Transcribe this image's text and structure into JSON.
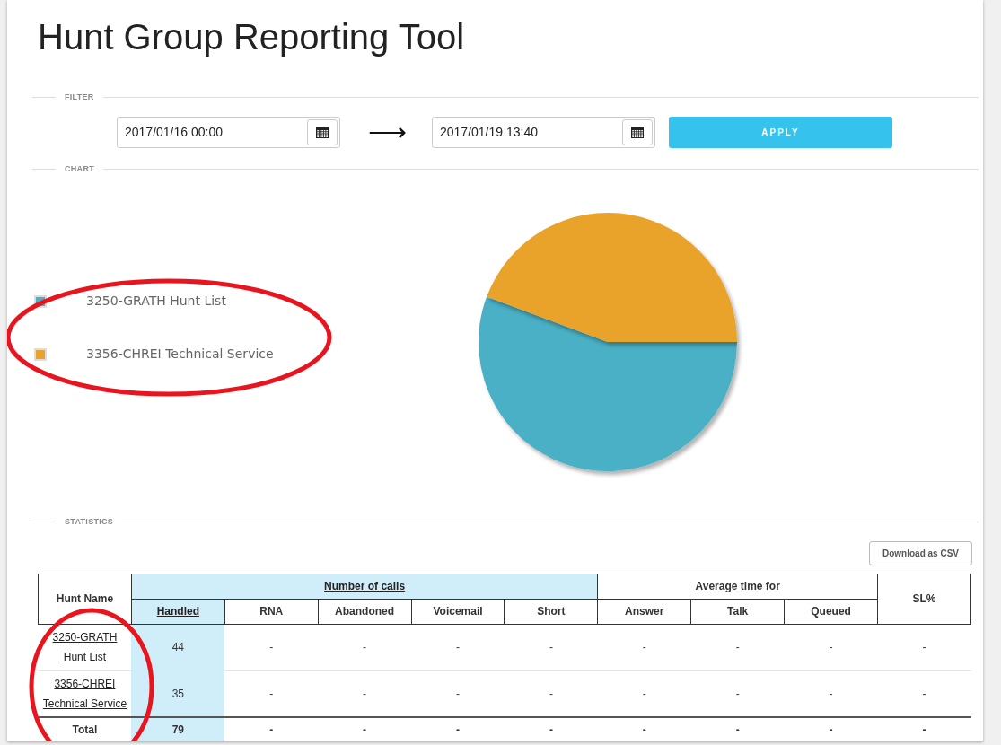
{
  "title": "Hunt Group Reporting Tool",
  "filter": {
    "section": "FILTER",
    "from": "2017/01/16 00:00",
    "arrow": "⟶",
    "to": "2017/01/19 13:40",
    "apply": "APPLY"
  },
  "chart": {
    "section": "CHART",
    "legend": [
      {
        "name": "3250-GRATH Hunt List",
        "color": "#4ab0c5"
      },
      {
        "name": "3356-CHREI Technical Service",
        "color": "#e9a22a"
      }
    ]
  },
  "statistics": {
    "section": "STATISTICS",
    "download": "Download as CSV"
  },
  "table": {
    "hunt_name_header": "Hunt Name",
    "sl_header": "SL%",
    "groups": [
      {
        "label": "Number of calls",
        "link": true,
        "highlighted": true,
        "columns": [
          {
            "label": "Handled",
            "link": true,
            "highlighted": true
          },
          {
            "label": "RNA",
            "link": false,
            "highlighted": false
          },
          {
            "label": "Abandoned",
            "link": false,
            "highlighted": false
          },
          {
            "label": "Voicemail",
            "link": false,
            "highlighted": false
          },
          {
            "label": "Short",
            "link": false,
            "highlighted": false
          }
        ]
      },
      {
        "label": "Average time for",
        "link": false,
        "highlighted": false,
        "columns": [
          {
            "label": "Answer",
            "link": false,
            "highlighted": false
          },
          {
            "label": "Talk",
            "link": false,
            "highlighted": false
          },
          {
            "label": "Queued",
            "link": false,
            "highlighted": false
          }
        ]
      }
    ],
    "rows": [
      {
        "kind": "entry",
        "name": "3250-GRATH Hunt List",
        "cells": [
          "44",
          "-",
          "-",
          "-",
          "-",
          "-",
          "-",
          "-",
          "-"
        ]
      },
      {
        "kind": "entry",
        "name": "3356-CHREI Technical Service",
        "cells": [
          "35",
          "-",
          "-",
          "-",
          "-",
          "-",
          "-",
          "-",
          "-"
        ]
      },
      {
        "kind": "total",
        "name": "Total",
        "cells": [
          "79",
          "-",
          "-",
          "-",
          "-",
          "-",
          "-",
          "-",
          "-"
        ]
      }
    ]
  },
  "annotations": [
    {
      "kind": "oval"
    },
    {
      "kind": "oval"
    }
  ]
}
